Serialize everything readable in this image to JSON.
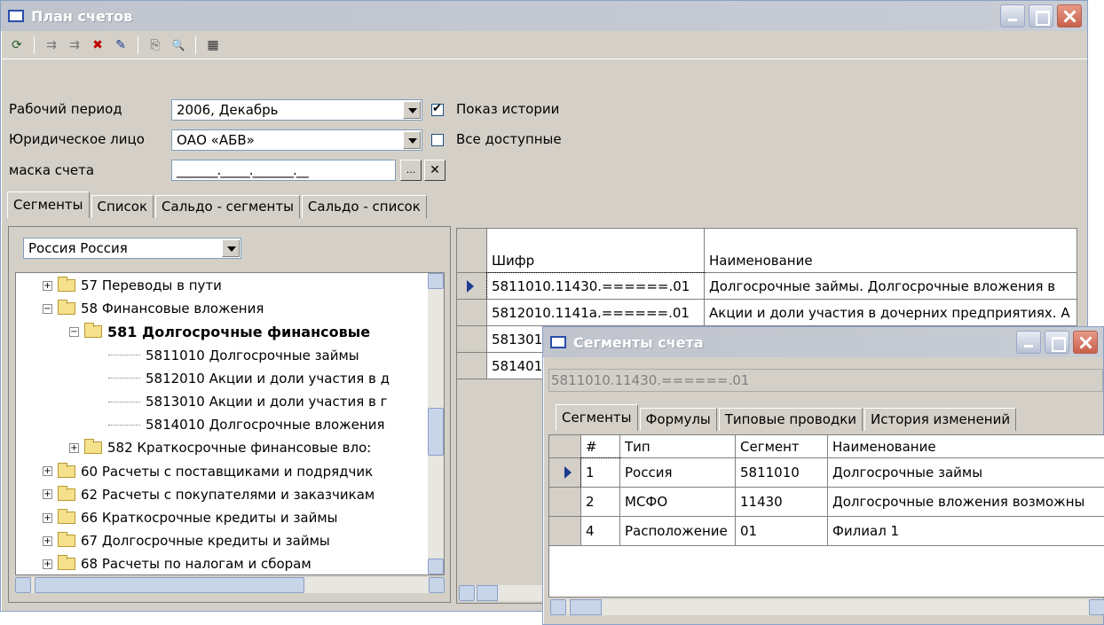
{
  "main_window": {
    "title": "План счетов",
    "toolbar": [
      {
        "name": "refresh-icon",
        "glyph": "⟳"
      },
      {
        "name": "move-in-icon",
        "glyph": "⇉"
      },
      {
        "name": "move-out-icon",
        "glyph": "⇉"
      },
      {
        "name": "delete-icon",
        "glyph": "✖"
      },
      {
        "name": "edit-icon",
        "glyph": "✎"
      },
      {
        "name": "copy-icon",
        "glyph": "⎘"
      },
      {
        "name": "find-icon",
        "glyph": "🔍"
      },
      {
        "name": "report-icon",
        "glyph": "▦"
      }
    ],
    "period_label": "Рабочий период",
    "period_value": "2006, Декабрь",
    "history_label": "Показ истории",
    "entity_label": "Юридическое лицо",
    "entity_value": "ОАО «АБВ»",
    "all_label": "Все доступные",
    "mask_label": "маска счета",
    "mask_value": "_______._____._______.__",
    "mask_browse": "...",
    "mask_clear": "✕",
    "tabs": [
      "Сегменты",
      "Список",
      "Сальдо - сегменты",
      "Сальдо - список"
    ],
    "segment_combo": "Россия Россия",
    "tree": [
      {
        "text": "57 Переводы в пути",
        "type": "folder",
        "pm": "+"
      },
      {
        "text": "58 Финансовые вложения",
        "type": "folder",
        "pm": "−"
      },
      {
        "text": "581 Долгосрочные финансовые",
        "type": "folder-open",
        "pm": "−",
        "bold": true
      },
      {
        "text": "5811010 Долгосрочные займы",
        "type": "leaf"
      },
      {
        "text": "5812010 Акции и доли участия в д",
        "type": "leaf"
      },
      {
        "text": "5813010 Акции и доли участия в г",
        "type": "leaf"
      },
      {
        "text": "5814010 Долгосрочные вложения",
        "type": "leaf"
      },
      {
        "text": "582 Краткосрочные финансовые вло:",
        "type": "folder",
        "pm": "+"
      },
      {
        "text": "60 Расчеты с поставщиками и подрядчик",
        "type": "folder",
        "pm": "+"
      },
      {
        "text": "62 Расчеты с покупателями и заказчикам",
        "type": "folder",
        "pm": "+"
      },
      {
        "text": "66 Краткосрочные кредиты и займы",
        "type": "folder",
        "pm": "+"
      },
      {
        "text": "67 Долгосрочные кредиты и займы",
        "type": "folder",
        "pm": "+"
      },
      {
        "text": "68 Расчеты по налогам и сборам",
        "type": "folder",
        "pm": "+"
      }
    ],
    "grid": {
      "headers": [
        "Шифр",
        "Наименование"
      ],
      "rows": [
        [
          "5811010.11430.======.01",
          "Долгосрочные займы. Долгосрочные вложения в"
        ],
        [
          "5812010.1141а.======.01",
          "Акции и доли участия в дочерних предприятиях. А"
        ],
        [
          "581301",
          ""
        ],
        [
          "581401",
          ""
        ]
      ]
    }
  },
  "seg_window": {
    "title": "Сегменты счета",
    "account": "5811010.11430.======.01",
    "tabs": [
      "Сегменты",
      "Формулы",
      "Типовые проводки",
      "История изменений"
    ],
    "headers": [
      "#",
      "Тип",
      "Сегмент",
      "Наименование"
    ],
    "rows": [
      [
        "1",
        "Россия",
        "5811010",
        "Долгосрочные займы"
      ],
      [
        "2",
        "МСФО",
        "11430",
        "Долгосрочные вложения возможны"
      ],
      [
        "4",
        "Расположение",
        "01",
        "Филиал 1"
      ]
    ]
  }
}
